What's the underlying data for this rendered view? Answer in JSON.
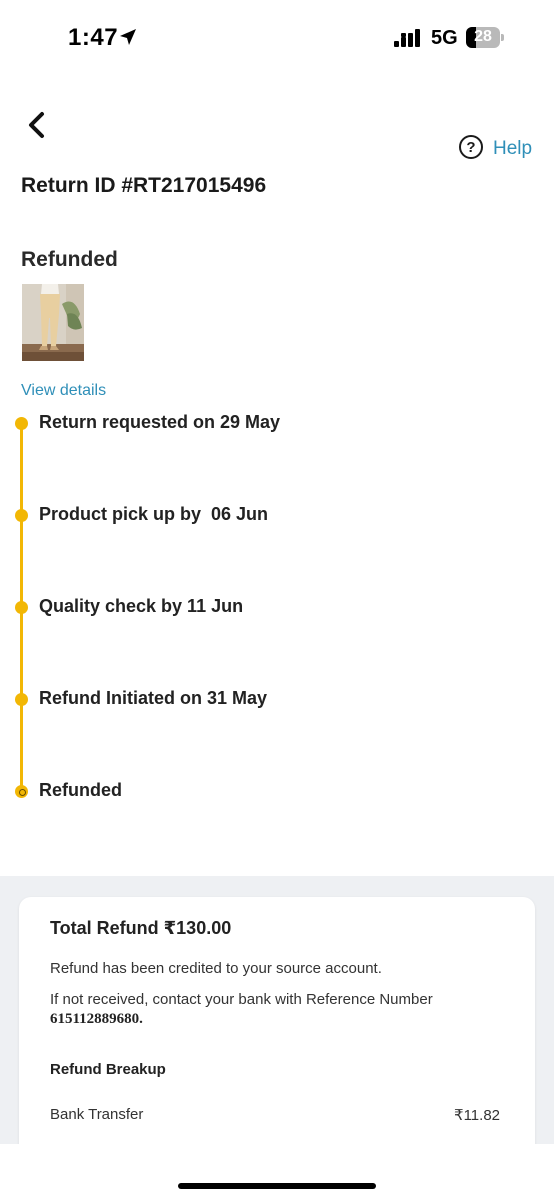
{
  "status_bar": {
    "time": "1:47",
    "network": "5G",
    "battery": "28"
  },
  "header": {
    "help_label": "Help"
  },
  "return": {
    "id_text": "Return ID #RT217015496",
    "status": "Refunded",
    "view_details_label": "View details"
  },
  "timeline": {
    "accent_color": "#f2b705",
    "steps": [
      {
        "label": "Return requested on 29 May"
      },
      {
        "label": "Product pick up by  06 Jun"
      },
      {
        "label": "Quality check by 11 Jun"
      },
      {
        "label": "Refund Initiated on 31 May"
      },
      {
        "label": "Refunded"
      }
    ]
  },
  "refund": {
    "total": "Total Refund ₹130.00",
    "message": "Refund has been credited to your source account.",
    "reference_prompt": "If not received, contact your bank with Reference Number",
    "reference_number": "615112889680.",
    "breakup_title": "Refund Breakup",
    "breakup": [
      {
        "label": "Bank Transfer",
        "value": "₹11.82"
      }
    ]
  },
  "colors": {
    "link": "#2f8fb8",
    "section_bg": "#eef0f3"
  }
}
